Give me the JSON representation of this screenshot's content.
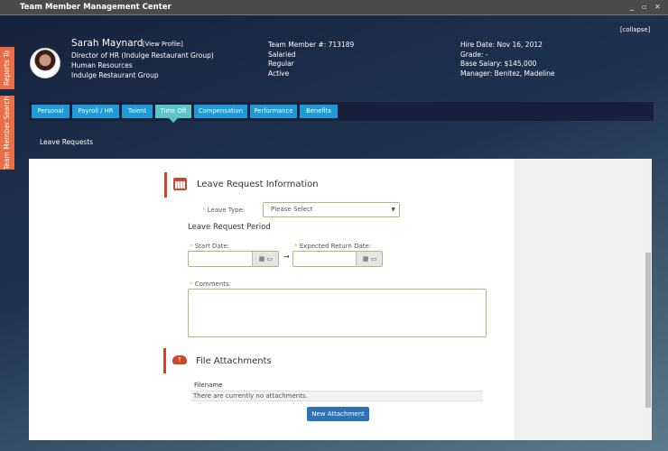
{
  "window": {
    "title": "Team Member Management Center",
    "minimize": "_",
    "restore": "▫",
    "close": "✕"
  },
  "side_tabs": [
    "Reports To",
    "Team Member Search"
  ],
  "profile": {
    "name": "Sarah Maynard",
    "view_profile": "[View Profile]",
    "title": "Director of HR (Indulge Restaurant Group)",
    "department": "Human Resources",
    "company": "Indulge Restaurant Group",
    "collapse": "[collapse]",
    "col2": [
      "Team Member #: 713189",
      "Salaried",
      "Regular",
      "Active"
    ],
    "col3": [
      "Hire Date: Nov 16, 2012",
      "Grade: -",
      "Base Salary: $145,000",
      "Manager: Benitez, Madeline"
    ]
  },
  "tabs": [
    {
      "label": "Personal"
    },
    {
      "label": "Payroll / HR"
    },
    {
      "label": "Talent"
    },
    {
      "label": "Time Off",
      "active": true
    },
    {
      "label": "Compensation"
    },
    {
      "label": "Performance"
    },
    {
      "label": "Benefits"
    }
  ],
  "breadcrumb": "Leave Requests",
  "form": {
    "section_title": "Leave Request Information",
    "leave_type_label": "Leave Type:",
    "leave_type_value": "Please Select",
    "period_title": "Leave Request Period",
    "start_label": "Start Date:",
    "return_label": "Expected Return Date:",
    "comments_label": "Comments:",
    "required": "*",
    "arrow": "→"
  },
  "attachments": {
    "title": "File Attachments",
    "column": "Filename",
    "empty": "There are currently no attachments.",
    "button": "New Attachment"
  },
  "colors": {
    "accent": "#c9482b",
    "tab": "#1e9ad8",
    "tab_active": "#5cc5c6",
    "side_tab": "#e86f48",
    "button": "#2e73b8"
  }
}
